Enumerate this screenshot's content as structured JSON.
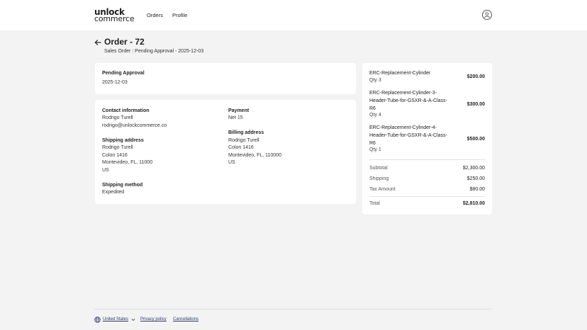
{
  "header": {
    "logo_line1": "unlock",
    "logo_line2": "commerce",
    "nav": {
      "orders": "Orders",
      "profile": "Profile"
    },
    "avatar_icon": "user-circle-icon"
  },
  "order": {
    "title": "Order - 72",
    "subtitle": "Sales Order : Pending Approval - 2025-12-03"
  },
  "status_card": {
    "status": "Pending Approval",
    "date": "2025-12-03"
  },
  "info_card": {
    "contact": {
      "heading": "Contact information",
      "name": "Rodrigo Turell",
      "email": "rodrigo@unlockcommerce.co"
    },
    "payment": {
      "heading": "Payment",
      "value": "Net 15"
    },
    "shipping_address": {
      "heading": "Shipping address",
      "name": "Rodrigo Turell",
      "line1": "Colon 1416",
      "line2": "Montevideo, FL, 11000",
      "country": "US"
    },
    "billing_address": {
      "heading": "Billing address",
      "name": "Rodrigo Turell",
      "line1": "Colon 1416",
      "line2": "Montevideo, FL, 110000",
      "country": "US"
    },
    "shipping_method": {
      "heading": "Shipping method",
      "value": "Expedited"
    }
  },
  "summary": {
    "items": [
      {
        "name_lines": [
          "ERC-Replacement-Cylinder"
        ],
        "qty": "Qty 3",
        "price": "$200.00"
      },
      {
        "name_lines": [
          "ERC-Replacement-Cylinder-3-",
          "Header-Tube-for-GSXR-&-A-Class-",
          "R6"
        ],
        "qty": "Qty 4",
        "price": "$300.00"
      },
      {
        "name_lines": [
          "ERC-Replacement-Cylinder-4-",
          "Header-Tube-for-GSXR-&-A-Class-",
          "R6"
        ],
        "qty": "Qty 1",
        "price": "$500.00"
      }
    ],
    "subtotal_label": "Subtotal",
    "subtotal": "$2,300.00",
    "shipping_label": "Shipping",
    "shipping": "$250.00",
    "tax_label": "Tax Amount",
    "tax": "$80.00",
    "total_label": "Total",
    "total": "$2,810.00"
  },
  "footer": {
    "region": "United States",
    "privacy": "Privacy policy",
    "cancellations": "Cancellations"
  },
  "colors": {
    "background": "#f3f3f4",
    "card": "#ffffff",
    "footer_link": "#2b3a6b"
  }
}
